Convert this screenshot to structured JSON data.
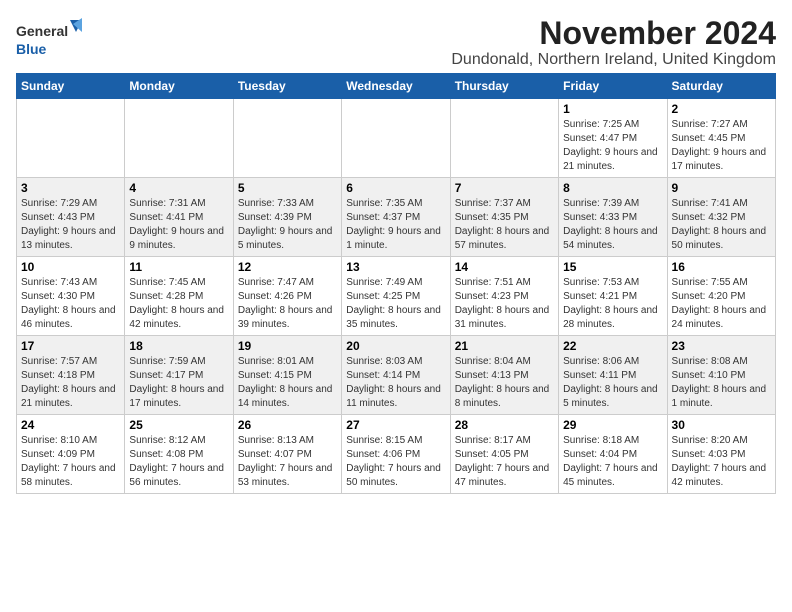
{
  "logo": {
    "text_general": "General",
    "text_blue": "Blue"
  },
  "title": "November 2024",
  "subtitle": "Dundonald, Northern Ireland, United Kingdom",
  "headers": [
    "Sunday",
    "Monday",
    "Tuesday",
    "Wednesday",
    "Thursday",
    "Friday",
    "Saturday"
  ],
  "weeks": [
    [
      {
        "day": "",
        "info": ""
      },
      {
        "day": "",
        "info": ""
      },
      {
        "day": "",
        "info": ""
      },
      {
        "day": "",
        "info": ""
      },
      {
        "day": "",
        "info": ""
      },
      {
        "day": "1",
        "info": "Sunrise: 7:25 AM\nSunset: 4:47 PM\nDaylight: 9 hours\nand 21 minutes."
      },
      {
        "day": "2",
        "info": "Sunrise: 7:27 AM\nSunset: 4:45 PM\nDaylight: 9 hours\nand 17 minutes."
      }
    ],
    [
      {
        "day": "3",
        "info": "Sunrise: 7:29 AM\nSunset: 4:43 PM\nDaylight: 9 hours\nand 13 minutes."
      },
      {
        "day": "4",
        "info": "Sunrise: 7:31 AM\nSunset: 4:41 PM\nDaylight: 9 hours\nand 9 minutes."
      },
      {
        "day": "5",
        "info": "Sunrise: 7:33 AM\nSunset: 4:39 PM\nDaylight: 9 hours\nand 5 minutes."
      },
      {
        "day": "6",
        "info": "Sunrise: 7:35 AM\nSunset: 4:37 PM\nDaylight: 9 hours\nand 1 minute."
      },
      {
        "day": "7",
        "info": "Sunrise: 7:37 AM\nSunset: 4:35 PM\nDaylight: 8 hours\nand 57 minutes."
      },
      {
        "day": "8",
        "info": "Sunrise: 7:39 AM\nSunset: 4:33 PM\nDaylight: 8 hours\nand 54 minutes."
      },
      {
        "day": "9",
        "info": "Sunrise: 7:41 AM\nSunset: 4:32 PM\nDaylight: 8 hours\nand 50 minutes."
      }
    ],
    [
      {
        "day": "10",
        "info": "Sunrise: 7:43 AM\nSunset: 4:30 PM\nDaylight: 8 hours\nand 46 minutes."
      },
      {
        "day": "11",
        "info": "Sunrise: 7:45 AM\nSunset: 4:28 PM\nDaylight: 8 hours\nand 42 minutes."
      },
      {
        "day": "12",
        "info": "Sunrise: 7:47 AM\nSunset: 4:26 PM\nDaylight: 8 hours\nand 39 minutes."
      },
      {
        "day": "13",
        "info": "Sunrise: 7:49 AM\nSunset: 4:25 PM\nDaylight: 8 hours\nand 35 minutes."
      },
      {
        "day": "14",
        "info": "Sunrise: 7:51 AM\nSunset: 4:23 PM\nDaylight: 8 hours\nand 31 minutes."
      },
      {
        "day": "15",
        "info": "Sunrise: 7:53 AM\nSunset: 4:21 PM\nDaylight: 8 hours\nand 28 minutes."
      },
      {
        "day": "16",
        "info": "Sunrise: 7:55 AM\nSunset: 4:20 PM\nDaylight: 8 hours\nand 24 minutes."
      }
    ],
    [
      {
        "day": "17",
        "info": "Sunrise: 7:57 AM\nSunset: 4:18 PM\nDaylight: 8 hours\nand 21 minutes."
      },
      {
        "day": "18",
        "info": "Sunrise: 7:59 AM\nSunset: 4:17 PM\nDaylight: 8 hours\nand 17 minutes."
      },
      {
        "day": "19",
        "info": "Sunrise: 8:01 AM\nSunset: 4:15 PM\nDaylight: 8 hours\nand 14 minutes."
      },
      {
        "day": "20",
        "info": "Sunrise: 8:03 AM\nSunset: 4:14 PM\nDaylight: 8 hours\nand 11 minutes."
      },
      {
        "day": "21",
        "info": "Sunrise: 8:04 AM\nSunset: 4:13 PM\nDaylight: 8 hours\nand 8 minutes."
      },
      {
        "day": "22",
        "info": "Sunrise: 8:06 AM\nSunset: 4:11 PM\nDaylight: 8 hours\nand 5 minutes."
      },
      {
        "day": "23",
        "info": "Sunrise: 8:08 AM\nSunset: 4:10 PM\nDaylight: 8 hours\nand 1 minute."
      }
    ],
    [
      {
        "day": "24",
        "info": "Sunrise: 8:10 AM\nSunset: 4:09 PM\nDaylight: 7 hours\nand 58 minutes."
      },
      {
        "day": "25",
        "info": "Sunrise: 8:12 AM\nSunset: 4:08 PM\nDaylight: 7 hours\nand 56 minutes."
      },
      {
        "day": "26",
        "info": "Sunrise: 8:13 AM\nSunset: 4:07 PM\nDaylight: 7 hours\nand 53 minutes."
      },
      {
        "day": "27",
        "info": "Sunrise: 8:15 AM\nSunset: 4:06 PM\nDaylight: 7 hours\nand 50 minutes."
      },
      {
        "day": "28",
        "info": "Sunrise: 8:17 AM\nSunset: 4:05 PM\nDaylight: 7 hours\nand 47 minutes."
      },
      {
        "day": "29",
        "info": "Sunrise: 8:18 AM\nSunset: 4:04 PM\nDaylight: 7 hours\nand 45 minutes."
      },
      {
        "day": "30",
        "info": "Sunrise: 8:20 AM\nSunset: 4:03 PM\nDaylight: 7 hours\nand 42 minutes."
      }
    ]
  ]
}
